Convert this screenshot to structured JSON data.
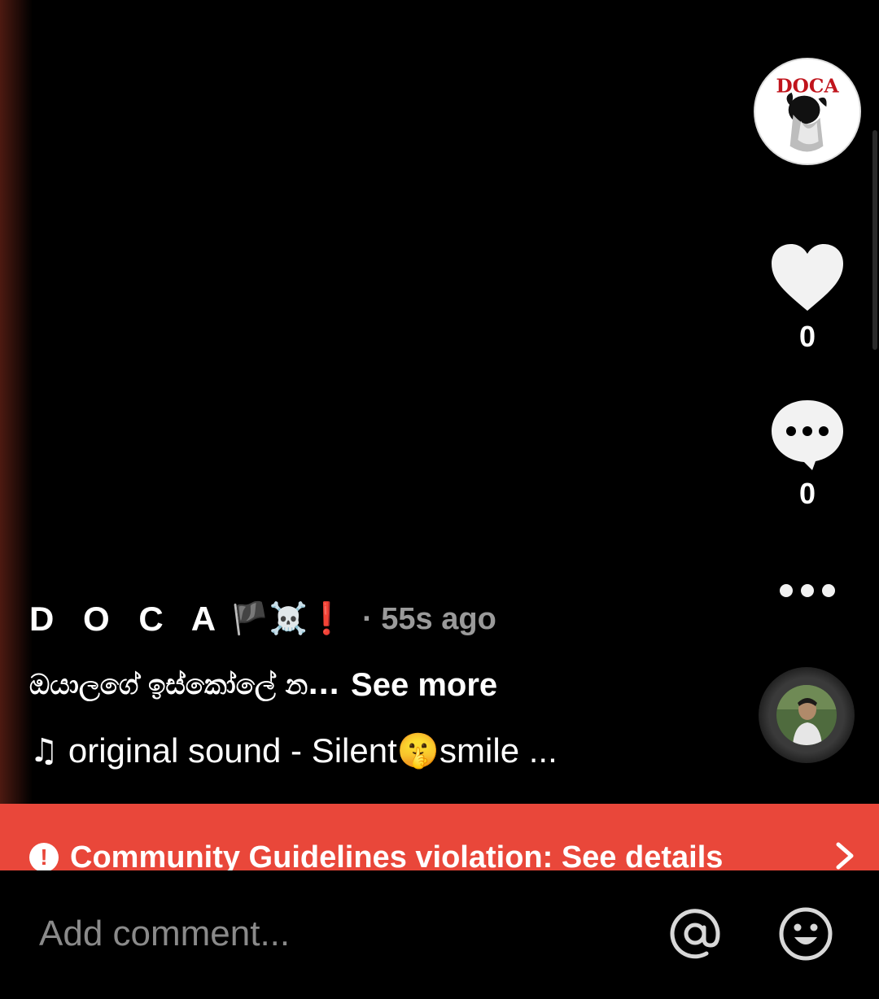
{
  "post": {
    "author": "D O C A",
    "author_emoji": "🏴☠️❗",
    "timestamp": "· 55s ago",
    "caption": "ඔයාලගේ ඉස්කෝලේ න...",
    "see_more": "See more",
    "sound_icon": "♫",
    "sound": "original sound - Silent🤫smile ..."
  },
  "actions": {
    "likes": "0",
    "comments": "0"
  },
  "avatar": {
    "logo_text": "DOCA"
  },
  "banner": {
    "alert_icon": "!",
    "text": "Community Guidelines violation: See details",
    "color": "#e9473a"
  },
  "comment_bar": {
    "placeholder": "Add comment..."
  },
  "icons": [
    "heart-icon",
    "comment-bubble-icon",
    "more-dots-icon",
    "chevron-right-icon",
    "at-mention-icon",
    "emoji-icon",
    "alert-icon",
    "music-note-icon"
  ]
}
